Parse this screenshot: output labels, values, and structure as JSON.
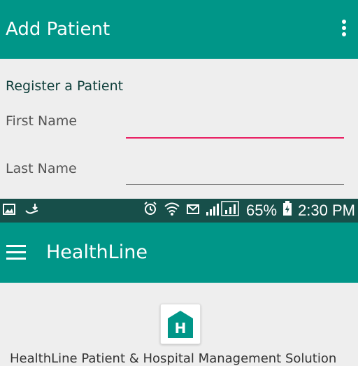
{
  "screen1": {
    "title": "Add Patient",
    "section_title": "Register a Patient",
    "fields": {
      "first_name_label": "First Name",
      "last_name_label": "Last Name",
      "first_name_value": "",
      "last_name_value": ""
    },
    "menu_icon": "more-vert-icon"
  },
  "statusbar": {
    "battery": "65%",
    "time": "2:30 PM",
    "icons_left": [
      "gallery-icon",
      "download-icon"
    ],
    "icons_right": [
      "alarm-icon",
      "wifi-icon",
      "message-icon",
      "signal-icon",
      "battery-icon"
    ]
  },
  "screen2": {
    "title": "HealthLine",
    "menu_icon": "hamburger-icon",
    "logo_letter": "H",
    "tagline": "HealthLine Patient & Hospital Management Solution"
  },
  "colors": {
    "primary": "#009688",
    "status_bar": "#174f4a",
    "accent": "#e91e63",
    "background": "#eeeeee"
  }
}
